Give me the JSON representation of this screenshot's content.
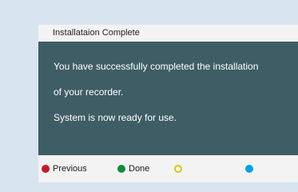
{
  "dialog": {
    "title": "Installataion Complete",
    "message_lines": [
      "You have successfully completed the installation",
      "of your recorder.",
      "System is now ready for use."
    ]
  },
  "buttons": [
    {
      "color": "red",
      "color_hex": "#c7182b",
      "label": "Previous"
    },
    {
      "color": "green",
      "color_hex": "#168a3a",
      "label": "Done"
    },
    {
      "color": "yellow",
      "color_hex": "#e1c200",
      "label": ""
    },
    {
      "color": "blue",
      "color_hex": "#00a0e8",
      "label": ""
    }
  ],
  "colors": {
    "background": "#d8e5f1",
    "panel": "#f3f3f3",
    "message_box": "#3f5d64"
  }
}
